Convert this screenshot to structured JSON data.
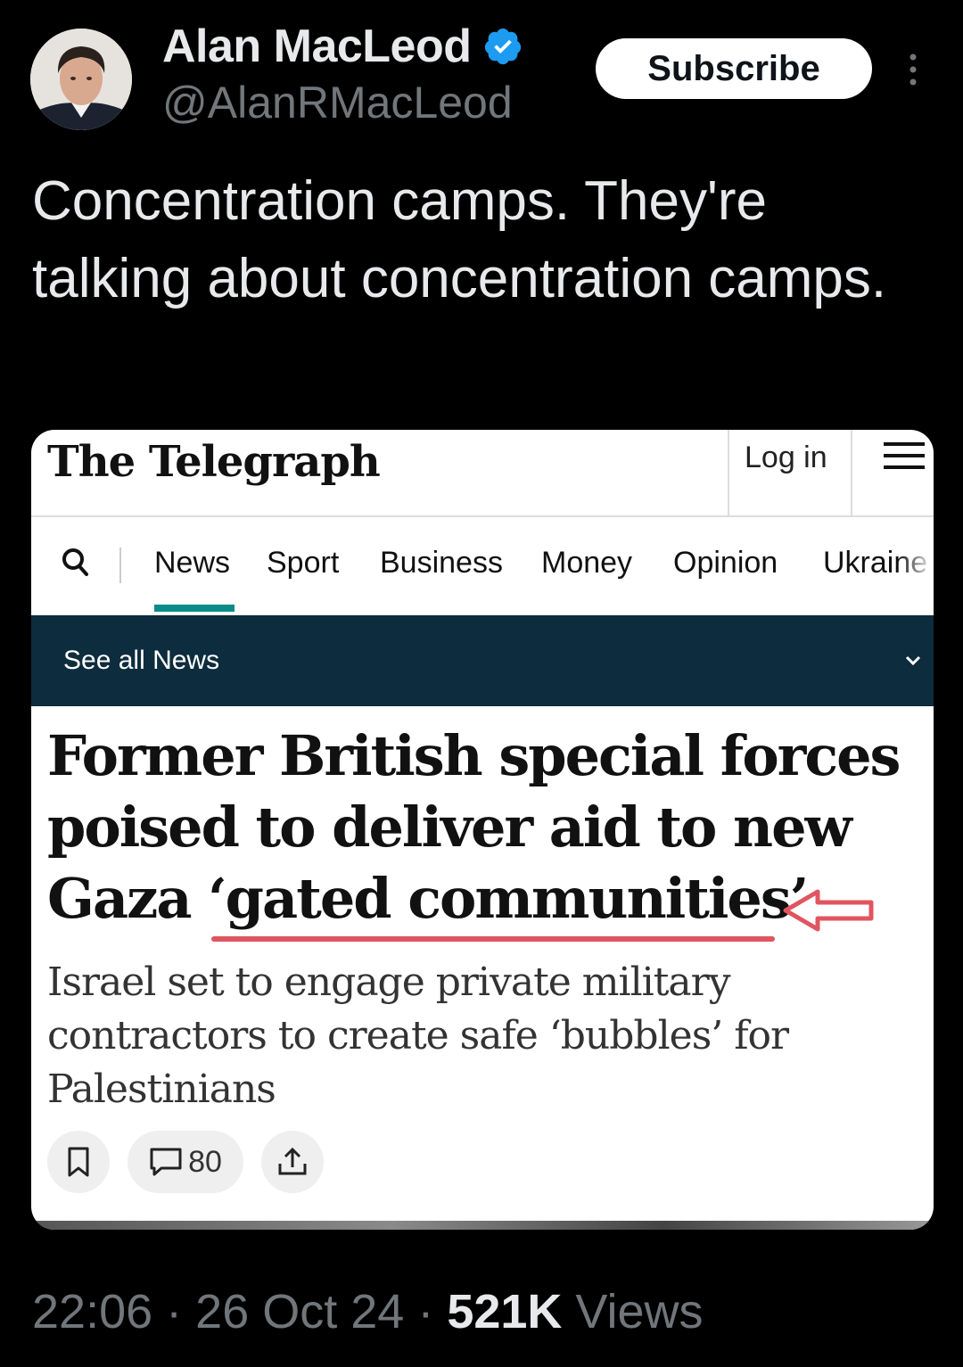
{
  "author": {
    "name": "Alan MacLeod",
    "handle": "@AlanRMacLeod",
    "verified": true,
    "avatar_icon": "avatar-photo"
  },
  "actions": {
    "subscribe_label": "Subscribe",
    "more_icon": "more-vertical-icon"
  },
  "tweet": {
    "text": "Concentration camps. They're talking about concentration camps."
  },
  "article": {
    "site_logo": "The Telegraph",
    "login_label": "Log in",
    "nav": [
      "News",
      "Sport",
      "Business",
      "Money",
      "Opinion",
      "Ukraine"
    ],
    "active_nav": "News",
    "see_all_label": "See all News",
    "headline_before": "Former British special forces poised to deliver aid to new Gaza ",
    "headline_highlight": "‘gated communities’",
    "subheadline": "Israel set to engage private military contractors to create safe ‘bubbles’ for Palestinians",
    "comment_count": "80",
    "accent_color": "#0b8a8a",
    "banner_color": "#0d2c3e",
    "annotation_color": "#e05560"
  },
  "meta": {
    "time": "22:06",
    "date": "26 Oct 24",
    "views_count": "521K",
    "views_label": "Views",
    "separator": "·"
  }
}
